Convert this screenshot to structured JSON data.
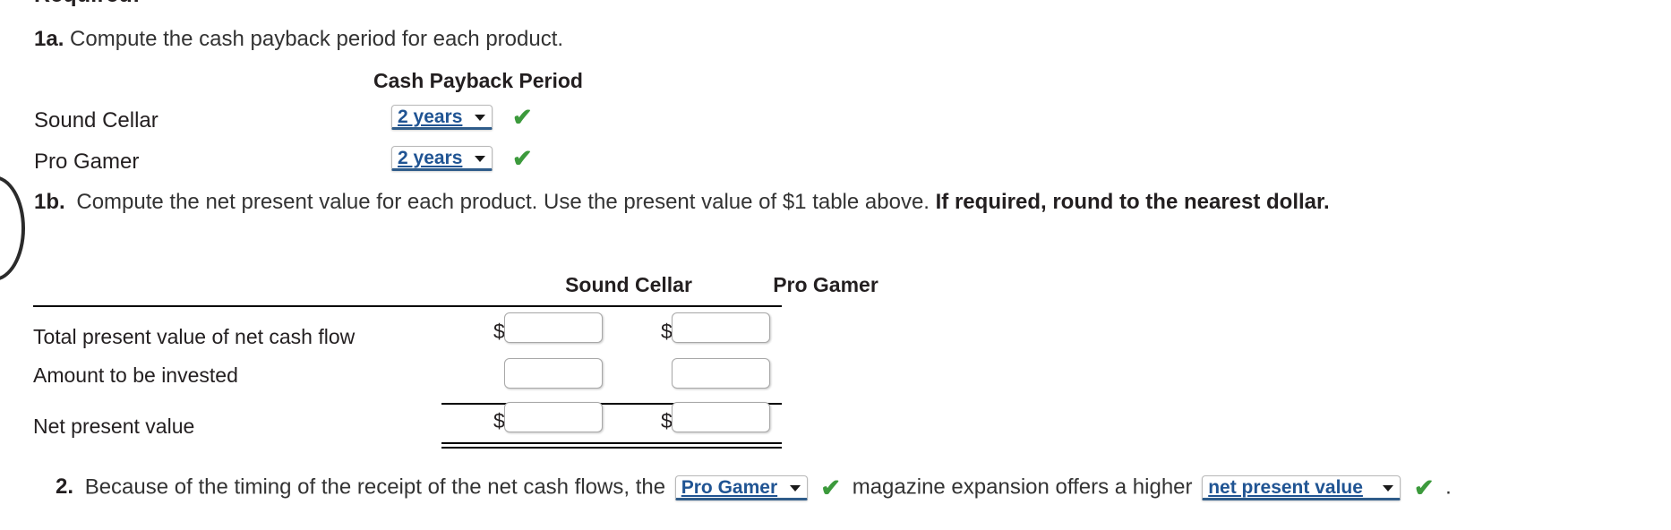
{
  "heading": {
    "required_label": "Required:"
  },
  "q1a": {
    "number": "1a.",
    "text": "Compute the cash payback period for each product.",
    "column_header": "Cash Payback Period",
    "rows": [
      {
        "label": "Sound Cellar",
        "value": "2 years",
        "status": "correct"
      },
      {
        "label": "Pro Gamer",
        "value": "2 years",
        "status": "correct"
      }
    ]
  },
  "q1b": {
    "number": "1b.",
    "text_normal": "Compute the net present value for each product. Use the present value of $1 table above.",
    "text_bold": "If required, round to the nearest dollar.",
    "table": {
      "columns": [
        "Sound Cellar",
        "Pro Gamer"
      ],
      "rows": [
        {
          "label": "Total present value of net cash flow",
          "cells": [
            {
              "prefix": "$",
              "value": "",
              "placeholder": ""
            },
            {
              "prefix": "$",
              "value": "",
              "placeholder": ""
            }
          ]
        },
        {
          "label": "Amount to be invested",
          "cells": [
            {
              "prefix": "",
              "value": "",
              "placeholder": ""
            },
            {
              "prefix": "",
              "value": "",
              "placeholder": ""
            }
          ]
        },
        {
          "label": "Net present value",
          "cells": [
            {
              "prefix": "$",
              "value": "",
              "placeholder": ""
            },
            {
              "prefix": "$",
              "value": "",
              "placeholder": ""
            }
          ]
        }
      ]
    }
  },
  "q2": {
    "number": "2.",
    "text_before": "Because of the timing of the receipt of the net cash flows, the",
    "dropdown_product": "Pro Gamer",
    "text_middle": "magazine expansion offers a higher",
    "dropdown_measure": "net present value",
    "text_after": "."
  },
  "icons": {
    "check": "✔",
    "caret": "chevron-down-icon"
  },
  "colors": {
    "dropdown_text": "#205493",
    "dropdown_underline": "#2f5c8a",
    "check_green": "#3c9a3c",
    "body_text": "#231f20",
    "rule": "#000000"
  }
}
